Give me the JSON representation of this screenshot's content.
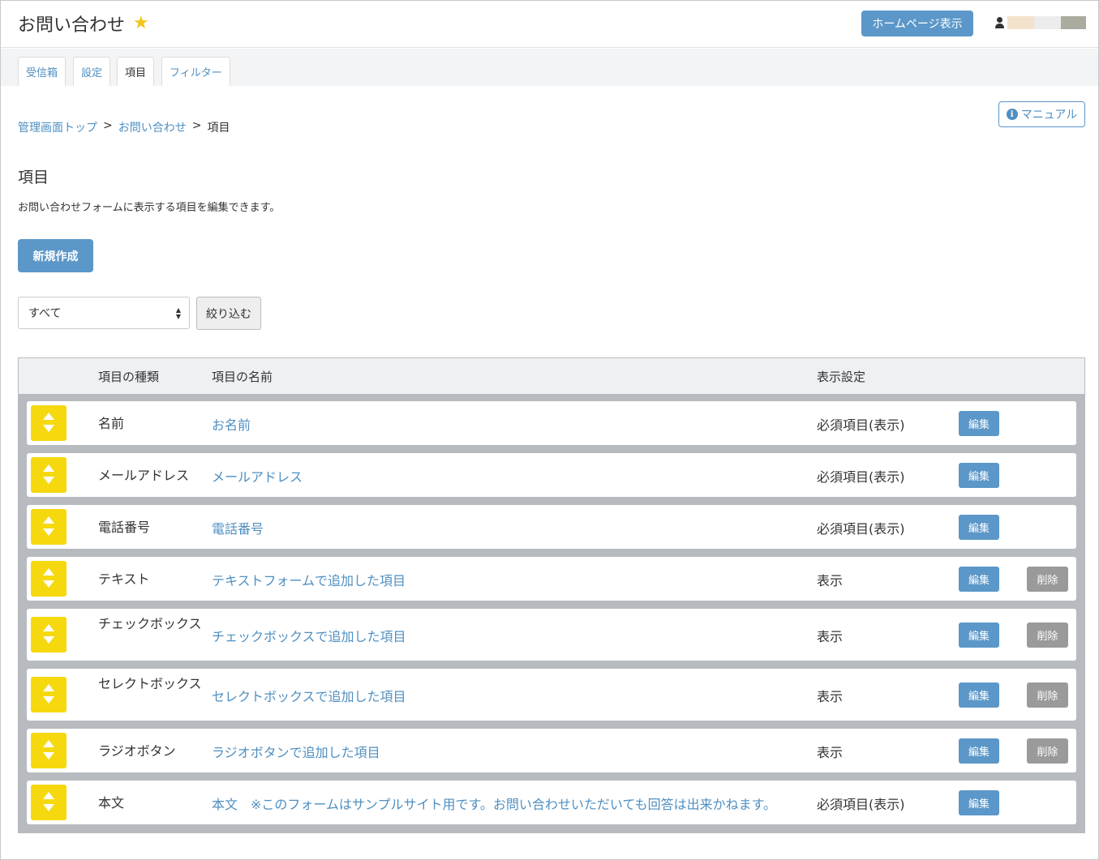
{
  "header": {
    "title": "お問い合わせ",
    "star_icon": "star-icon",
    "homepage_button": "ホームページ表示",
    "user_icon": "user-icon",
    "user_name_colors": [
      "#f3e3cd",
      "#ececec",
      "#ababa0"
    ]
  },
  "tabs": [
    {
      "label": "受信箱"
    },
    {
      "label": "設定"
    },
    {
      "label": "項目"
    },
    {
      "label": "フィルター"
    }
  ],
  "active_tab": "項目",
  "manual_button": {
    "icon": "info-icon",
    "icon_glyph": "i",
    "label": "マニュアル"
  },
  "breadcrumb": {
    "items": [
      "管理画面トップ",
      "お問い合わせ",
      "項目"
    ],
    "separator": ">"
  },
  "page": {
    "title": "項目",
    "description": "お問い合わせフォームに表示する項目を編集できます。",
    "new_button": "新規作成"
  },
  "filter": {
    "selected": "すべて",
    "button": "絞り込む"
  },
  "table": {
    "headers": [
      "項目の種類",
      "項目の名前",
      "表示設定"
    ],
    "edit_label": "編集",
    "delete_label": "削除",
    "rows": [
      {
        "type": "名前",
        "name": "お名前",
        "display": "必須項目(表示)",
        "deletable": false
      },
      {
        "type": "メールアドレス",
        "name": "メールアドレス",
        "display": "必須項目(表示)",
        "deletable": false
      },
      {
        "type": "電話番号",
        "name": "電話番号",
        "display": "必須項目(表示)",
        "deletable": false
      },
      {
        "type": "テキスト",
        "name": "テキストフォームで追加した項目",
        "display": "表示",
        "deletable": true
      },
      {
        "type": "チェックボックス",
        "name": "チェックボックスで追加した項目",
        "display": "表示",
        "deletable": true
      },
      {
        "type": "セレクトボックス",
        "name": "セレクトボックスで追加した項目",
        "display": "表示",
        "deletable": true
      },
      {
        "type": "ラジオボタン",
        "name": "ラジオボタンで追加した項目",
        "display": "表示",
        "deletable": true
      },
      {
        "type": "本文",
        "name": "本文　※このフォームはサンプルサイト用です。お問い合わせいただいても回答は出来かねます。",
        "display": "必須項目(表示)",
        "deletable": false
      }
    ]
  },
  "colors": {
    "primary": "#5b97c8",
    "link": "#4f8fc1",
    "handle": "#f6d80f",
    "delete": "#9a9a9a",
    "table_bg": "#b7bbbf"
  }
}
